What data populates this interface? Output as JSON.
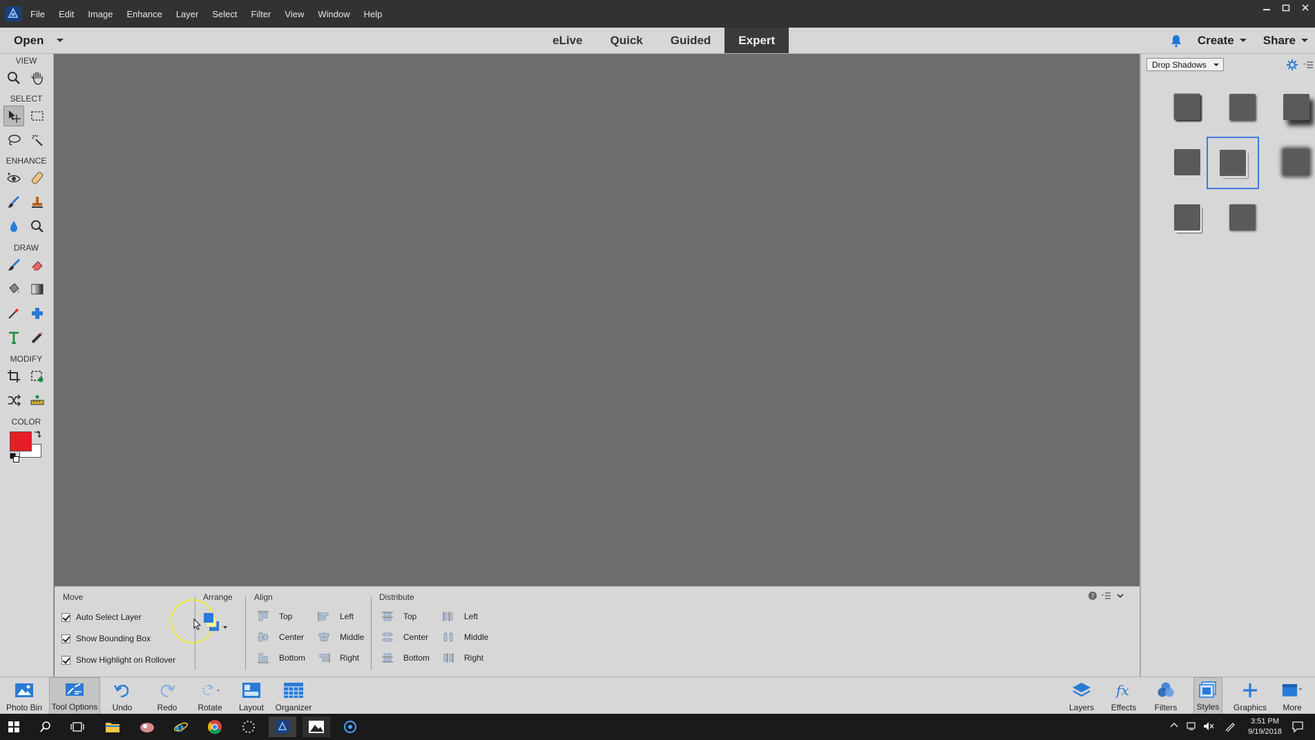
{
  "menubar": {
    "items": [
      "File",
      "Edit",
      "Image",
      "Enhance",
      "Layer",
      "Select",
      "Filter",
      "View",
      "Window",
      "Help"
    ],
    "window_controls": [
      "minimize",
      "restore",
      "close"
    ]
  },
  "modebar": {
    "open_label": "Open",
    "modes": [
      {
        "label": "eLive",
        "active": false
      },
      {
        "label": "Quick",
        "active": false
      },
      {
        "label": "Guided",
        "active": false
      },
      {
        "label": "Expert",
        "active": true
      }
    ],
    "create_label": "Create",
    "share_label": "Share"
  },
  "toolbox": {
    "sections": {
      "view": "VIEW",
      "select": "SELECT",
      "enhance": "ENHANCE",
      "draw": "DRAW",
      "modify": "MODIFY",
      "color": "COLOR"
    },
    "foreground_color": "#e31e24",
    "background_color": "#ffffff"
  },
  "right_panel": {
    "category": "Drop Shadows",
    "selected_index": 4
  },
  "tool_options": {
    "move_header": "Move",
    "arrange_header": "Arrange",
    "align_header": "Align",
    "distribute_header": "Distribute",
    "checkboxes": [
      {
        "label": "Auto Select Layer",
        "checked": true
      },
      {
        "label": "Show Bounding Box",
        "checked": true
      },
      {
        "label": "Show Highlight on Rollover",
        "checked": true
      }
    ],
    "align_col1": [
      "Top",
      "Center",
      "Bottom"
    ],
    "align_col2": [
      "Left",
      "Middle",
      "Right"
    ],
    "distribute_col1": [
      "Top",
      "Center",
      "Bottom"
    ],
    "distribute_col2": [
      "Left",
      "Middle",
      "Right"
    ]
  },
  "taskbar": {
    "left": [
      "Photo Bin",
      "Tool Options",
      "Undo",
      "Redo",
      "Rotate",
      "Layout",
      "Organizer"
    ],
    "right": [
      "Layers",
      "Effects",
      "Filters",
      "Styles",
      "Graphics",
      "More"
    ]
  },
  "windows": {
    "time": "3:51 PM",
    "date": "9/19/2018"
  }
}
